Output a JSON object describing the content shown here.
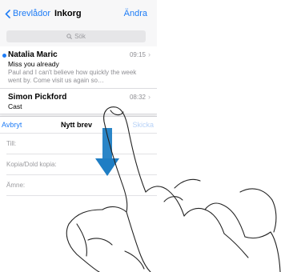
{
  "navbar": {
    "back_label": "Brevlådor",
    "title": "Inkorg",
    "edit_label": "Ändra"
  },
  "search": {
    "placeholder": "Sök"
  },
  "mails": [
    {
      "sender": "Natalia Maric",
      "time": "09:15",
      "subject": "Miss you already",
      "preview": "Paul and I can't believe how quickly the week went by. Come visit us again so…",
      "unread": true
    },
    {
      "sender": "Simon Pickford",
      "time": "08:32",
      "subject": "Cast",
      "preview": "",
      "unread": false
    }
  ],
  "compose": {
    "cancel_label": "Avbryt",
    "title": "Nytt brev",
    "send_label": "Skicka",
    "to_label": "Till:",
    "cc_label": "Kopia/Dold kopia:",
    "subject_label": "Ämne:"
  },
  "colors": {
    "accent": "#1e7cf6",
    "arrow": "#1f7ec4"
  },
  "icons": {
    "back": "chevron-left-icon",
    "search": "search-icon",
    "disclosure": "chevron-right-icon",
    "gesture": "swipe-down-arrow-icon"
  }
}
